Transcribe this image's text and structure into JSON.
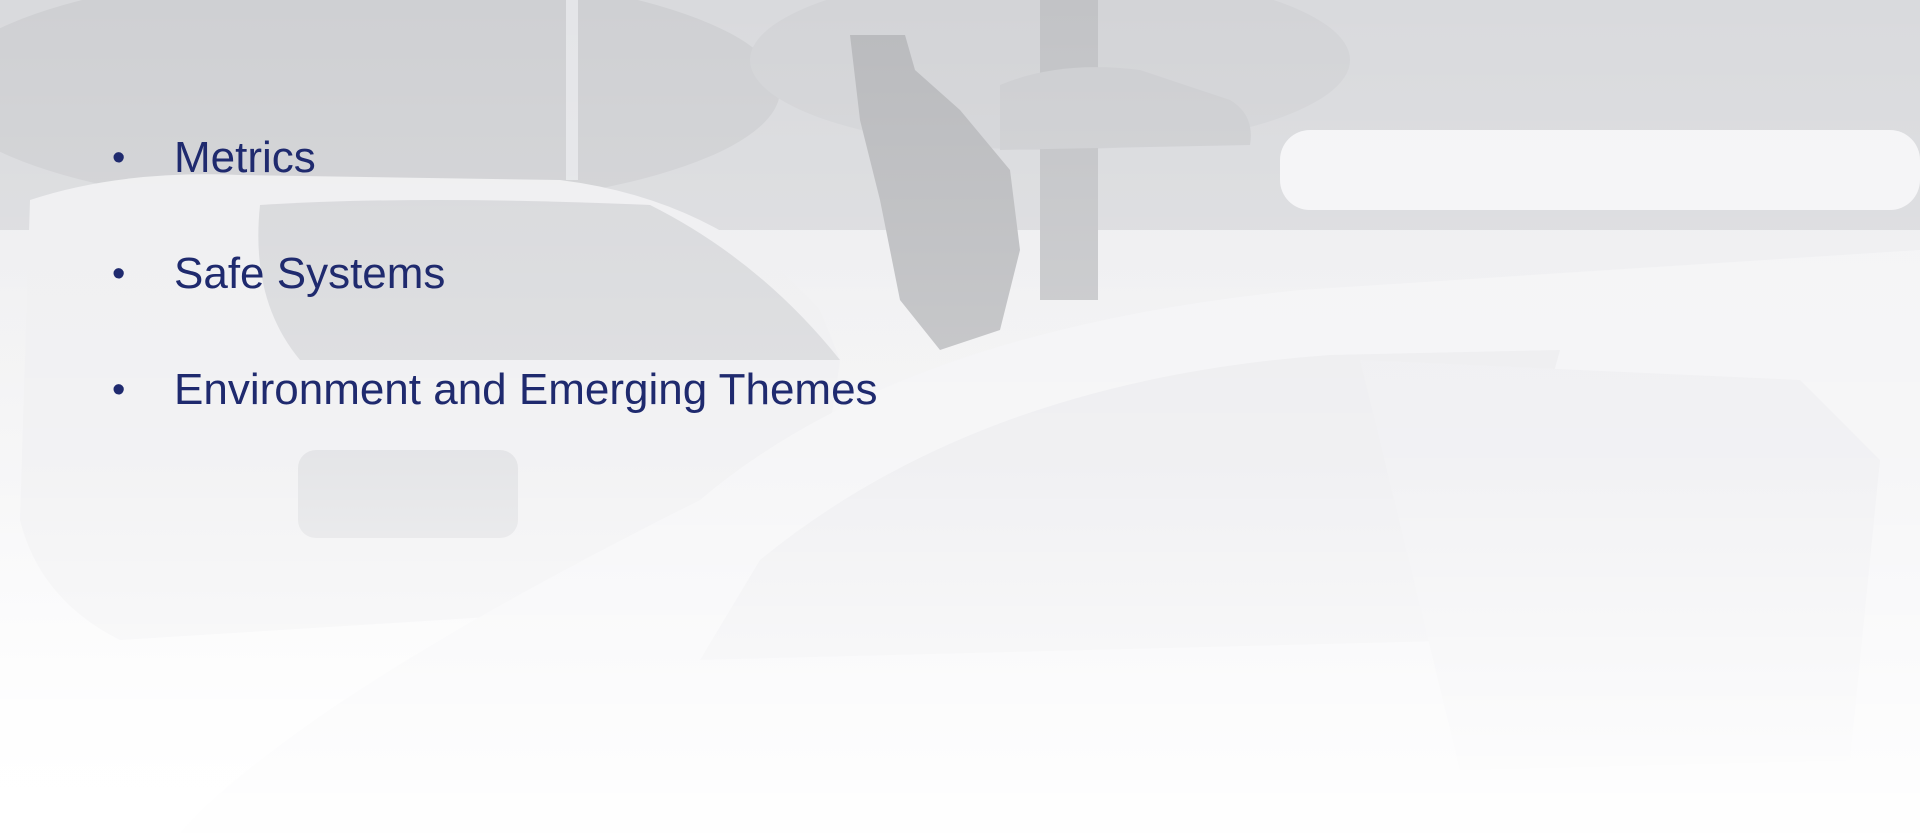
{
  "slide": {
    "bullets": [
      {
        "label": "Metrics"
      },
      {
        "label": "Safe Systems"
      },
      {
        "label": "Environment and Emerging Themes"
      }
    ],
    "bullet_symbol": "•"
  },
  "theme": {
    "text_color": "#1f2a6e",
    "background_color": "#f2f2f4",
    "accent_red": "#c84b4b"
  },
  "background_image": {
    "subject": "faded grayscale photo of a police traffic stop"
  }
}
